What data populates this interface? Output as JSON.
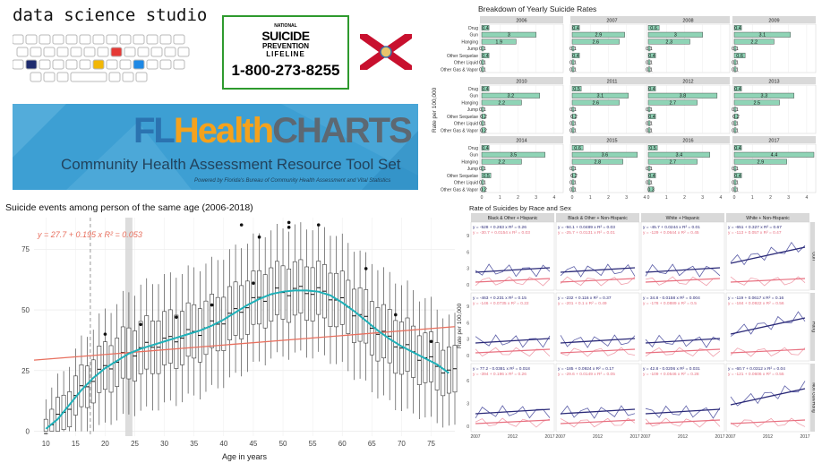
{
  "header": {
    "studio": "data science studio"
  },
  "lifeline": {
    "line1": "SUICIDE",
    "line2": "PREVENTION",
    "line3": "LIFELINE",
    "phone": "1-800-273-8255",
    "small_top": "NATIONAL"
  },
  "banner": {
    "title_fl": "FL",
    "title_health": "Health",
    "title_charts": "CHARTS",
    "subtitle": "Community Health Assessment Resource Tool Set",
    "powered": "Powered by Florida's Bureau of Community Health Assessment and Vital Statistics"
  },
  "colors": {
    "bar_fill": "#8fd4b6",
    "loess": "#1fb0b8",
    "trend": "#e8705f",
    "navy": "#2b2a78",
    "pink": "#e87080",
    "strip": "#d9d9d9"
  },
  "chart_data": [
    {
      "type": "bar",
      "title": "Breakdown of Yearly Suicide Rates",
      "ylabel": "Rate per 100,000",
      "categories": [
        "Drug",
        "Gun",
        "Hanging",
        "Jump",
        "Other Sequelae",
        "Other Liquid",
        "Other Gas & Vapor"
      ],
      "xticks": [
        0,
        1,
        2,
        3,
        4
      ],
      "xlim": [
        0,
        4.4
      ],
      "panels": [
        {
          "year": "2006",
          "values": [
            0.4,
            3,
            1.9,
            0.1,
            0.4,
            0.1,
            0.1
          ]
        },
        {
          "year": "2007",
          "values": [
            0.4,
            2.9,
            2.6,
            0.1,
            0.4,
            0.1,
            0.1
          ]
        },
        {
          "year": "2008",
          "values": [
            0.6,
            3,
            2.3,
            0.1,
            0.4,
            0.1,
            0.1
          ]
        },
        {
          "year": "2009",
          "values": [
            0.4,
            3.1,
            2.2,
            0.1,
            0.6,
            0.1,
            0.1
          ]
        },
        {
          "year": "2010",
          "values": [
            0.4,
            3.2,
            2.2,
            0.1,
            0.2,
            0.1,
            0.2
          ]
        },
        {
          "year": "2011",
          "values": [
            0.5,
            3.1,
            2.6,
            0.1,
            0.2,
            0.1,
            0.1
          ]
        },
        {
          "year": "2012",
          "values": [
            0.4,
            3.8,
            2.7,
            0.1,
            0.4,
            0.1,
            0.1
          ]
        },
        {
          "year": "2013",
          "values": [
            0.4,
            3.3,
            2.5,
            0.1,
            0.2,
            0.1,
            0.1
          ]
        },
        {
          "year": "2014",
          "values": [
            0.4,
            3.5,
            2.2,
            0.1,
            0.5,
            0.1,
            0.2
          ]
        },
        {
          "year": "2015",
          "values": [
            0.6,
            3.6,
            2.8,
            0.1,
            0.2,
            0.1,
            0.1
          ]
        },
        {
          "year": "2016",
          "values": [
            0.5,
            3.4,
            2.7,
            0.1,
            0.4,
            0.1,
            0.3
          ]
        },
        {
          "year": "2017",
          "values": [
            0.4,
            4.4,
            2.9,
            0.1,
            0.4,
            0.1,
            0.1
          ]
        }
      ]
    },
    {
      "type": "box",
      "title": "Suicide events among person of the same age (2006-2018)",
      "xlabel": "Age in years",
      "ylabel": "",
      "xlim": [
        8,
        79
      ],
      "ylim": [
        -2,
        88
      ],
      "xticks": [
        10,
        15,
        20,
        25,
        30,
        35,
        40,
        45,
        50,
        55,
        60,
        65,
        70,
        75
      ],
      "yticks": [
        0,
        25,
        50,
        75
      ],
      "annotation": "y = 27.7 + 0.195 x   R² = 0.053",
      "vline_x": 17.5,
      "shade_x": 24,
      "trend": [
        {
          "x": 8,
          "y": 29.3
        },
        {
          "x": 79,
          "y": 43.1
        }
      ],
      "loess": [
        {
          "x": 10,
          "y": 1
        },
        {
          "x": 12,
          "y": 5
        },
        {
          "x": 14,
          "y": 11
        },
        {
          "x": 16,
          "y": 17
        },
        {
          "x": 18,
          "y": 22
        },
        {
          "x": 20,
          "y": 26
        },
        {
          "x": 22,
          "y": 29
        },
        {
          "x": 24,
          "y": 32
        },
        {
          "x": 26,
          "y": 34
        },
        {
          "x": 28,
          "y": 35.5
        },
        {
          "x": 30,
          "y": 37
        },
        {
          "x": 32,
          "y": 38.5
        },
        {
          "x": 34,
          "y": 40
        },
        {
          "x": 36,
          "y": 41.5
        },
        {
          "x": 38,
          "y": 43.5
        },
        {
          "x": 40,
          "y": 46
        },
        {
          "x": 42,
          "y": 49
        },
        {
          "x": 44,
          "y": 52
        },
        {
          "x": 46,
          "y": 54.5
        },
        {
          "x": 48,
          "y": 56.5
        },
        {
          "x": 50,
          "y": 57.5
        },
        {
          "x": 52,
          "y": 58
        },
        {
          "x": 54,
          "y": 58
        },
        {
          "x": 56,
          "y": 57.5
        },
        {
          "x": 58,
          "y": 56
        },
        {
          "x": 60,
          "y": 53
        },
        {
          "x": 62,
          "y": 49.5
        },
        {
          "x": 64,
          "y": 45.5
        },
        {
          "x": 66,
          "y": 41.5
        },
        {
          "x": 68,
          "y": 38
        },
        {
          "x": 70,
          "y": 35
        },
        {
          "x": 72,
          "y": 32.5
        },
        {
          "x": 74,
          "y": 30
        },
        {
          "x": 76,
          "y": 27.5
        },
        {
          "x": 78,
          "y": 24
        }
      ],
      "outliers": [
        {
          "x": 20,
          "y": 40
        },
        {
          "x": 26,
          "y": 44
        },
        {
          "x": 32,
          "y": 47
        },
        {
          "x": 38,
          "y": 52
        },
        {
          "x": 43,
          "y": 85
        },
        {
          "x": 45,
          "y": 61
        },
        {
          "x": 46,
          "y": 80
        },
        {
          "x": 51,
          "y": 86
        },
        {
          "x": 51,
          "y": 84
        },
        {
          "x": 56,
          "y": 85
        },
        {
          "x": 64,
          "y": 67
        },
        {
          "x": 69,
          "y": 48
        },
        {
          "x": 75,
          "y": 37
        }
      ]
    },
    {
      "type": "line",
      "title": "Rate of Suicides by Race and Sex",
      "ylabel": "Rate per 100,000",
      "xticks": [
        "2007",
        "2012",
        "2017"
      ],
      "columns": [
        "Black & Other + Hispanic",
        "Black & Other + Non-Hispanic",
        "White + Hispanic",
        "White + Non-Hispanic"
      ],
      "rows": [
        "Gun",
        "Hang",
        "Non Gun/Hang"
      ],
      "series_names": [
        "navy",
        "pink"
      ],
      "equations": [
        [
          [
            "y = -528 + 0.263 x   R² = 0.26",
            "y = -30.7 + 0.0154 x   R² = 0.03"
          ],
          [
            "y = -94.1 + 0.0489 x   R² = 0.03",
            "y = -25.7 + 0.0131 x   R² = 0.01"
          ],
          [
            "y = -45.7 + 0.0244 x   R² = 0.01",
            "y = -129 + 0.0644 x   R² = 0.45"
          ],
          [
            "y = -651 + 0.327 x   R² = 0.67",
            "y = -113 + 0.057 x   R² = 0.47"
          ]
        ],
        [
          [
            "y = -463 + 0.231 x   R² = 0.15",
            "y = -146 + 0.0735 x   R² = 0.22"
          ],
          [
            "y = -232 + 0.116 x   R² = 0.37",
            "y = -201 + 0.1 x   R² = 0.49"
          ],
          [
            "y = 34.8 - 0.0158 x   R² = 0.004",
            "y = -178 + 0.0889 x   R² = 0.5"
          ],
          [
            "y = -119 + 0.0617 x   R² = 0.16",
            "y = -184 + 0.0922 x   R² = 0.56"
          ]
        ],
        [
          [
            "y = 77.2 - 0.0381 x   R² = 0.018",
            "y = -394 + 0.196 x   R² = 0.26"
          ],
          [
            "y = -185 + 0.0924 x   R² = 0.17",
            "y = -29.6 + 0.0149 x   R² = 0.05"
          ],
          [
            "y = 42.8 - 0.0206 x   R² = 0.031",
            "y = -109 + 0.0546 x   R² = 0.28"
          ],
          [
            "y = -60.7 + 0.0312 x   R² = 0.04",
            "y = -121 + 0.0606 x   R² = 0.55"
          ]
        ]
      ],
      "yticks": [
        [
          0,
          3,
          6,
          9
        ],
        [
          0,
          3,
          6,
          9
        ],
        [
          0,
          3,
          6
        ]
      ]
    }
  ]
}
